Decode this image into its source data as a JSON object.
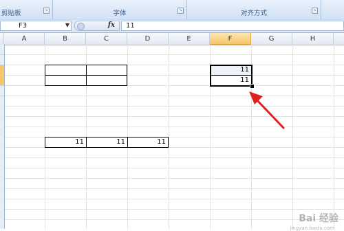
{
  "ribbon": {
    "groups": [
      {
        "label": "剪贴板"
      },
      {
        "label": "字体"
      },
      {
        "label": "对齐方式"
      }
    ]
  },
  "formula_bar": {
    "name_box": "F3",
    "fx_label": "fx",
    "formula_value": "11"
  },
  "columns": [
    "A",
    "B",
    "C",
    "D",
    "E",
    "F",
    "G",
    "H"
  ],
  "selected_column": "F",
  "cells": {
    "F2": "11",
    "F3": "11",
    "B9": "11",
    "C9": "11",
    "D9": "11"
  },
  "colors": {
    "selection_header": "#f6c66b",
    "arrow": "#e02020"
  },
  "watermark": {
    "text": "Bai 经验",
    "sub": "jingyan.baidu.com"
  }
}
